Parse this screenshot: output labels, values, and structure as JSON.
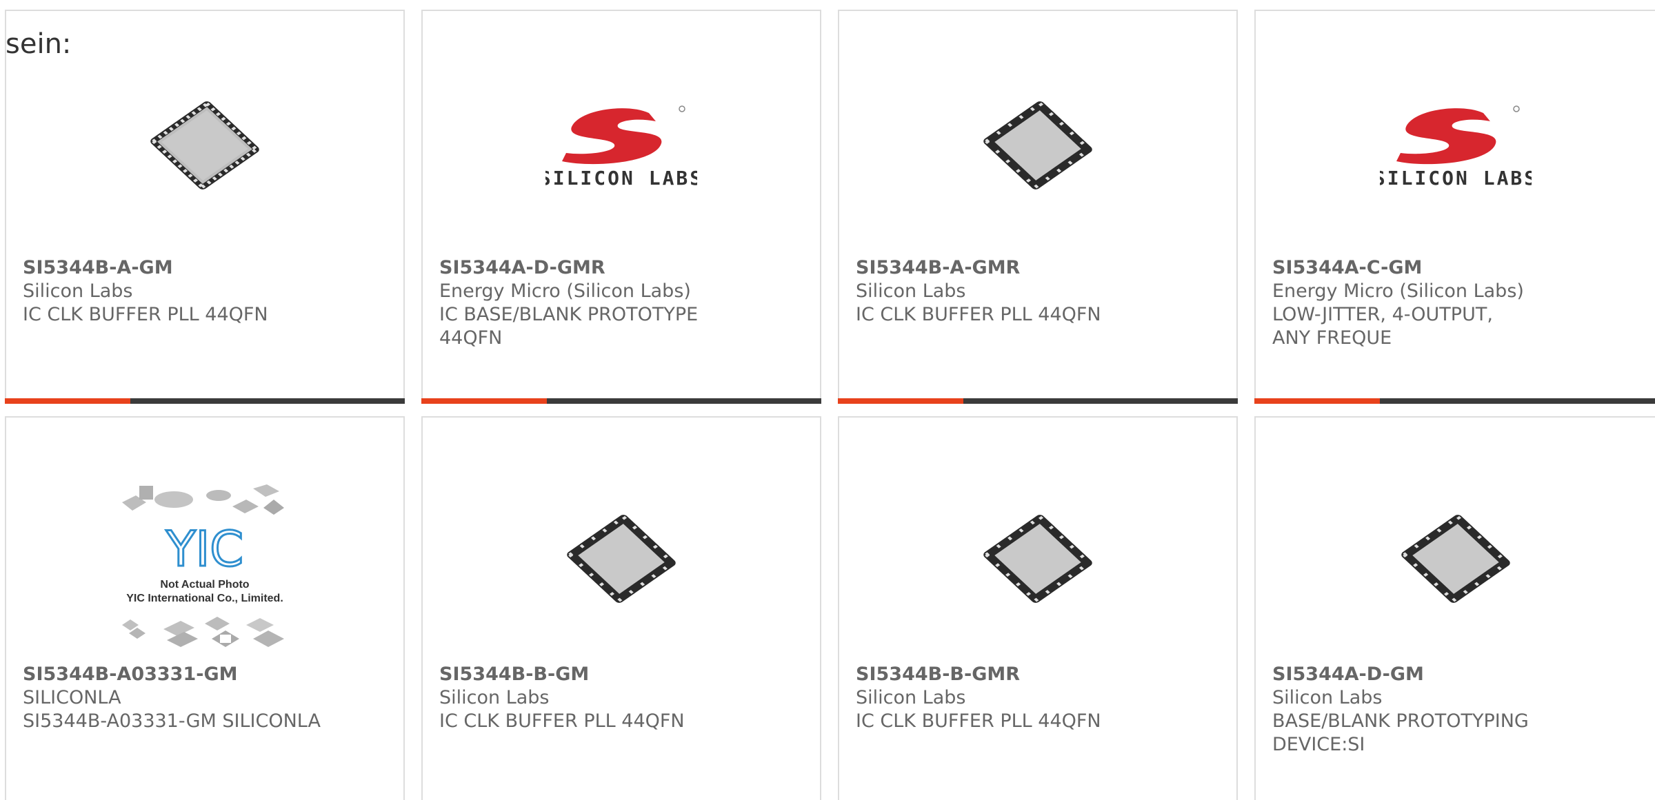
{
  "intro_text": "sein:",
  "colors": {
    "accent": "#e8421c",
    "bar": "#3b3b3b",
    "border": "#dddddd",
    "text": "#666666",
    "logo_red": "#d7262e"
  },
  "products": [
    {
      "part_number": "SI5344B-A-GM",
      "manufacturer": "Silicon Labs",
      "description": "IC CLK BUFFER PLL 44QFN",
      "image": "qfn-chip-icon"
    },
    {
      "part_number": "SI5344A-D-GMR",
      "manufacturer": "Energy Micro (Silicon Labs)",
      "description": "IC BASE/BLANK PROTOTYPE 44QFN",
      "image": "silicon-labs-logo",
      "logo_text": "SILICON LABS"
    },
    {
      "part_number": "SI5344B-A-GMR",
      "manufacturer": "Silicon Labs",
      "description": "IC CLK BUFFER PLL 44QFN",
      "image": "qfn-chip-icon"
    },
    {
      "part_number": "SI5344A-C-GM",
      "manufacturer": "Energy Micro (Silicon Labs)",
      "description": "LOW-JITTER, 4-OUTPUT, ANY FREQUE",
      "image": "silicon-labs-logo",
      "logo_text": "SILICON LABS"
    },
    {
      "part_number": "SI5344B-A03331-GM",
      "manufacturer": "SILICONLA",
      "description": "SI5344B-A03331-GM SILICONLA",
      "image": "yic-placeholder",
      "placeholder_line1": "Not Actual Photo",
      "placeholder_line2": "YIC International Co., Limited.",
      "placeholder_logo": "YIC"
    },
    {
      "part_number": "SI5344B-B-GM",
      "manufacturer": "Silicon Labs",
      "description": "IC CLK BUFFER PLL 44QFN",
      "image": "qfn-chip-icon"
    },
    {
      "part_number": "SI5344B-B-GMR",
      "manufacturer": "Silicon Labs",
      "description": "IC CLK BUFFER PLL 44QFN",
      "image": "qfn-chip-icon"
    },
    {
      "part_number": "SI5344A-D-GM",
      "manufacturer": "Silicon Labs",
      "description": "BASE/BLANK PROTOTYPING DEVICE:SI",
      "image": "qfn-chip-icon"
    }
  ]
}
